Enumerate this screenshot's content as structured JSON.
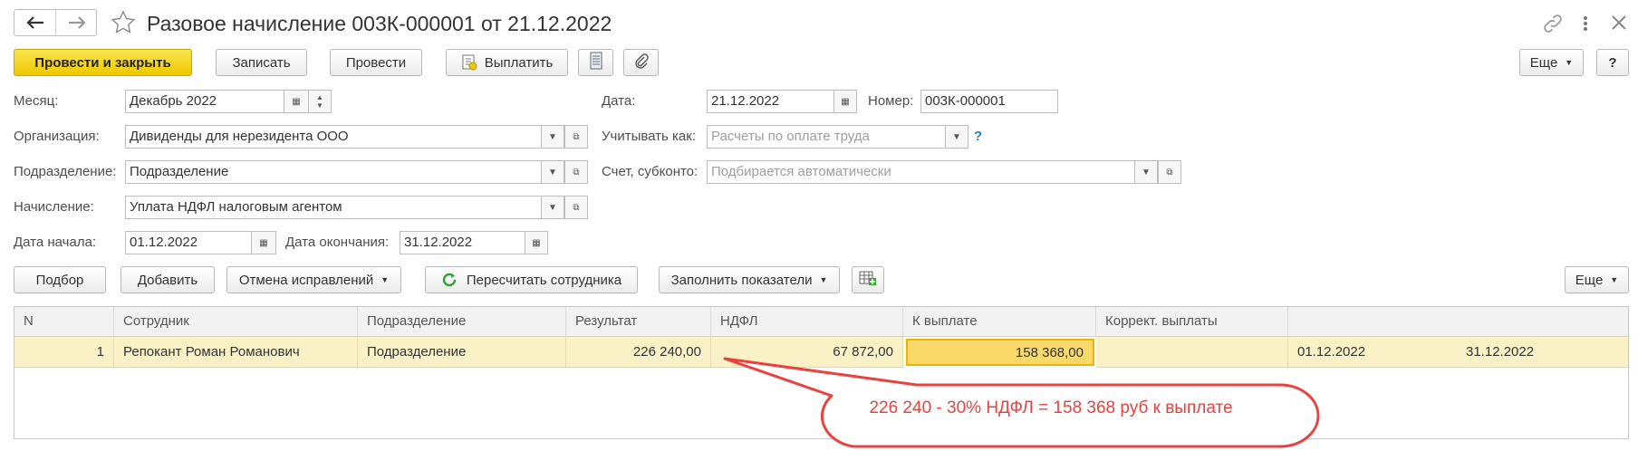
{
  "window": {
    "title": "Разовое начисление 003К-000001 от 21.12.2022"
  },
  "toolbar": {
    "post_close": "Провести и закрыть",
    "save": "Записать",
    "post": "Провести",
    "pay": "Выплатить",
    "more": "Еще",
    "help": "?"
  },
  "form": {
    "month_label": "Месяц:",
    "month_value": "Декабрь 2022",
    "date_label": "Дата:",
    "date_value": "21.12.2022",
    "number_label": "Номер:",
    "number_value": "003К-000001",
    "org_label": "Организация:",
    "org_value": "Дивиденды для нерезидента ООО",
    "account_as_label": "Учитывать как:",
    "account_as_placeholder": "Расчеты по оплате труда",
    "help_mark": "?",
    "dept_label": "Подразделение:",
    "dept_value": "Подразделение",
    "account_label": "Счет, субконто:",
    "account_placeholder": "Подбирается автоматически",
    "accrual_label": "Начисление:",
    "accrual_value": "Уплата НДФЛ налоговым агентом",
    "start_label": "Дата начала:",
    "start_value": "01.12.2022",
    "end_label": "Дата окончания:",
    "end_value": "31.12.2022"
  },
  "table_toolbar": {
    "select": "Подбор",
    "add": "Добавить",
    "cancel_fix": "Отмена исправлений",
    "recalc": "Пересчитать сотрудника",
    "fill": "Заполнить показатели",
    "more": "Еще"
  },
  "table": {
    "headers": [
      "N",
      "Сотрудник",
      "Подразделение",
      "Результат",
      "НДФЛ",
      "К выплате",
      "Коррект. выплаты",
      ""
    ],
    "rows": [
      [
        "1",
        "Репокант Роман Романович",
        "Подразделение",
        "226 240,00",
        "67 872,00",
        "158 368,00",
        "",
        "01.12.2022",
        "31.12.2022"
      ]
    ]
  },
  "callout": {
    "text": "226 240 - 30% НДФЛ = 158 368 руб к выплате",
    "color": "#e8433f"
  }
}
